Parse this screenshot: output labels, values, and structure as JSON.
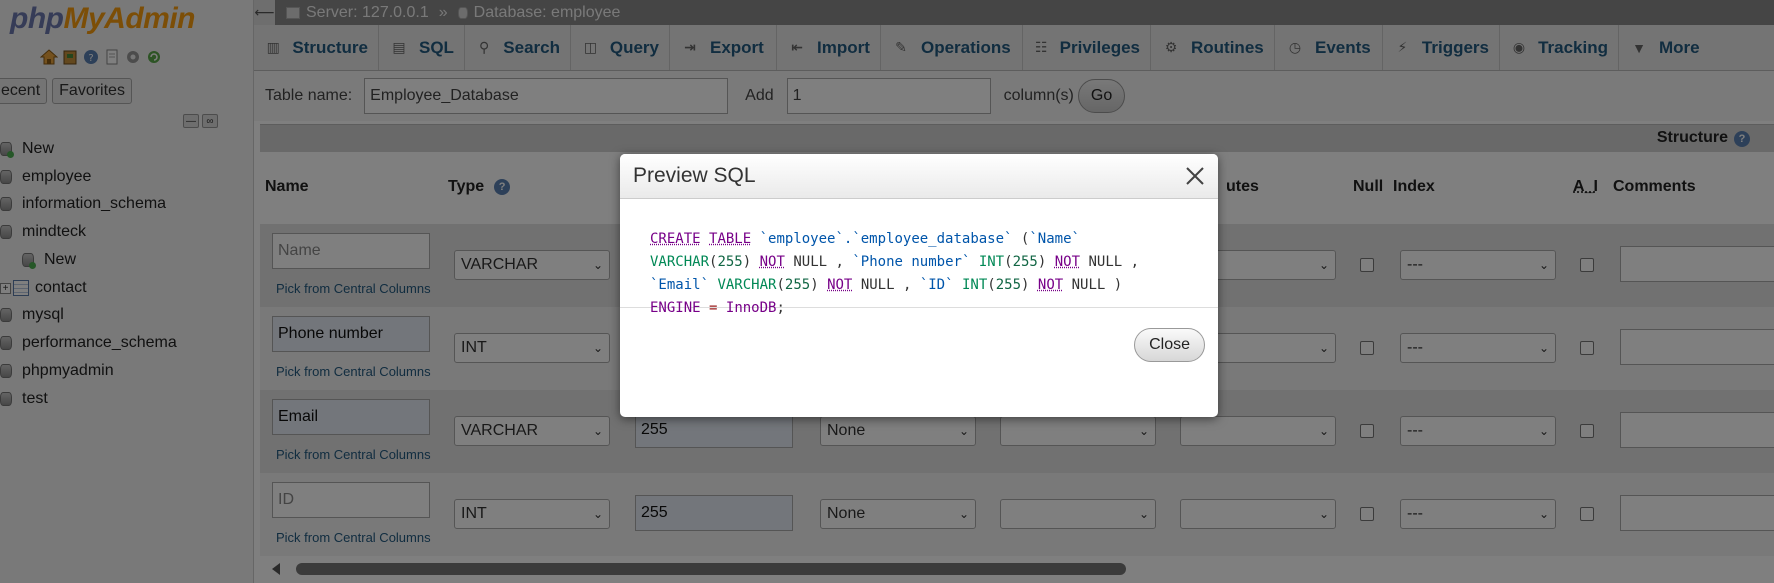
{
  "app": {
    "logo_part1": "php",
    "logo_part2": "MyAdmin"
  },
  "sidebar": {
    "tabs": [
      "ecent",
      "Favorites"
    ],
    "tree": [
      {
        "label": "New",
        "kind": "new"
      },
      {
        "label": "employee",
        "kind": "db"
      },
      {
        "label": "information_schema",
        "kind": "db"
      },
      {
        "label": "mindteck",
        "kind": "db"
      },
      {
        "label": "contact",
        "kind": "table"
      },
      {
        "label": "New",
        "kind": "new-child"
      },
      {
        "label": "mysql",
        "kind": "db"
      },
      {
        "label": "performance_schema",
        "kind": "db"
      },
      {
        "label": "phpmyadmin",
        "kind": "db"
      },
      {
        "label": "test",
        "kind": "db"
      }
    ]
  },
  "breadcrumb": {
    "server": "Server: 127.0.0.1",
    "separator": "»",
    "database": "Database: employee"
  },
  "menu": {
    "tabs": [
      {
        "label": "Structure",
        "icon": "structure-icon"
      },
      {
        "label": "SQL",
        "icon": "sql-icon"
      },
      {
        "label": "Search",
        "icon": "search-icon"
      },
      {
        "label": "Query",
        "icon": "query-icon"
      },
      {
        "label": "Export",
        "icon": "export-icon"
      },
      {
        "label": "Import",
        "icon": "import-icon"
      },
      {
        "label": "Operations",
        "icon": "wrench-icon"
      },
      {
        "label": "Privileges",
        "icon": "privileges-icon"
      },
      {
        "label": "Routines",
        "icon": "routines-icon"
      },
      {
        "label": "Events",
        "icon": "clock-icon"
      },
      {
        "label": "Triggers",
        "icon": "triggers-icon"
      },
      {
        "label": "Tracking",
        "icon": "eye-icon"
      },
      {
        "label": "More",
        "icon": "chevron-down-icon"
      }
    ]
  },
  "table_form": {
    "table_name_label": "Table name:",
    "table_name_value": "Employee_Database",
    "add_label": "Add",
    "add_value": "1",
    "columns_label": "column(s)",
    "go_label": "Go"
  },
  "structure": {
    "section_label": "Structure",
    "headers": {
      "name": "Name",
      "type": "Type",
      "attributes": "utes",
      "null": "Null",
      "index": "Index",
      "ai": "A_I",
      "comments": "Comments"
    },
    "pick_label": "Pick from Central Columns",
    "rows": [
      {
        "name": "",
        "name_placeholder": "Name",
        "type": "VARCHAR",
        "length": "",
        "default": "",
        "index": "---"
      },
      {
        "name": "Phone number",
        "name_placeholder": "",
        "type": "INT",
        "length": "",
        "default": "",
        "index": "---"
      },
      {
        "name": "Email",
        "name_placeholder": "",
        "type": "VARCHAR",
        "length": "255",
        "default": "None",
        "index": "---"
      },
      {
        "name": "",
        "name_placeholder": "ID",
        "type": "INT",
        "length": "255",
        "default": "None",
        "index": "---"
      }
    ]
  },
  "dialog": {
    "title": "Preview SQL",
    "sql_text": "CREATE TABLE `employee`.`employee_database` (`Name` VARCHAR(255) NOT NULL , `Phone number` INT(255) NOT NULL , `Email` VARCHAR(255) NOT NULL , `ID` INT(255) NOT NULL ) ENGINE = InnoDB;",
    "close_label": "Close"
  }
}
